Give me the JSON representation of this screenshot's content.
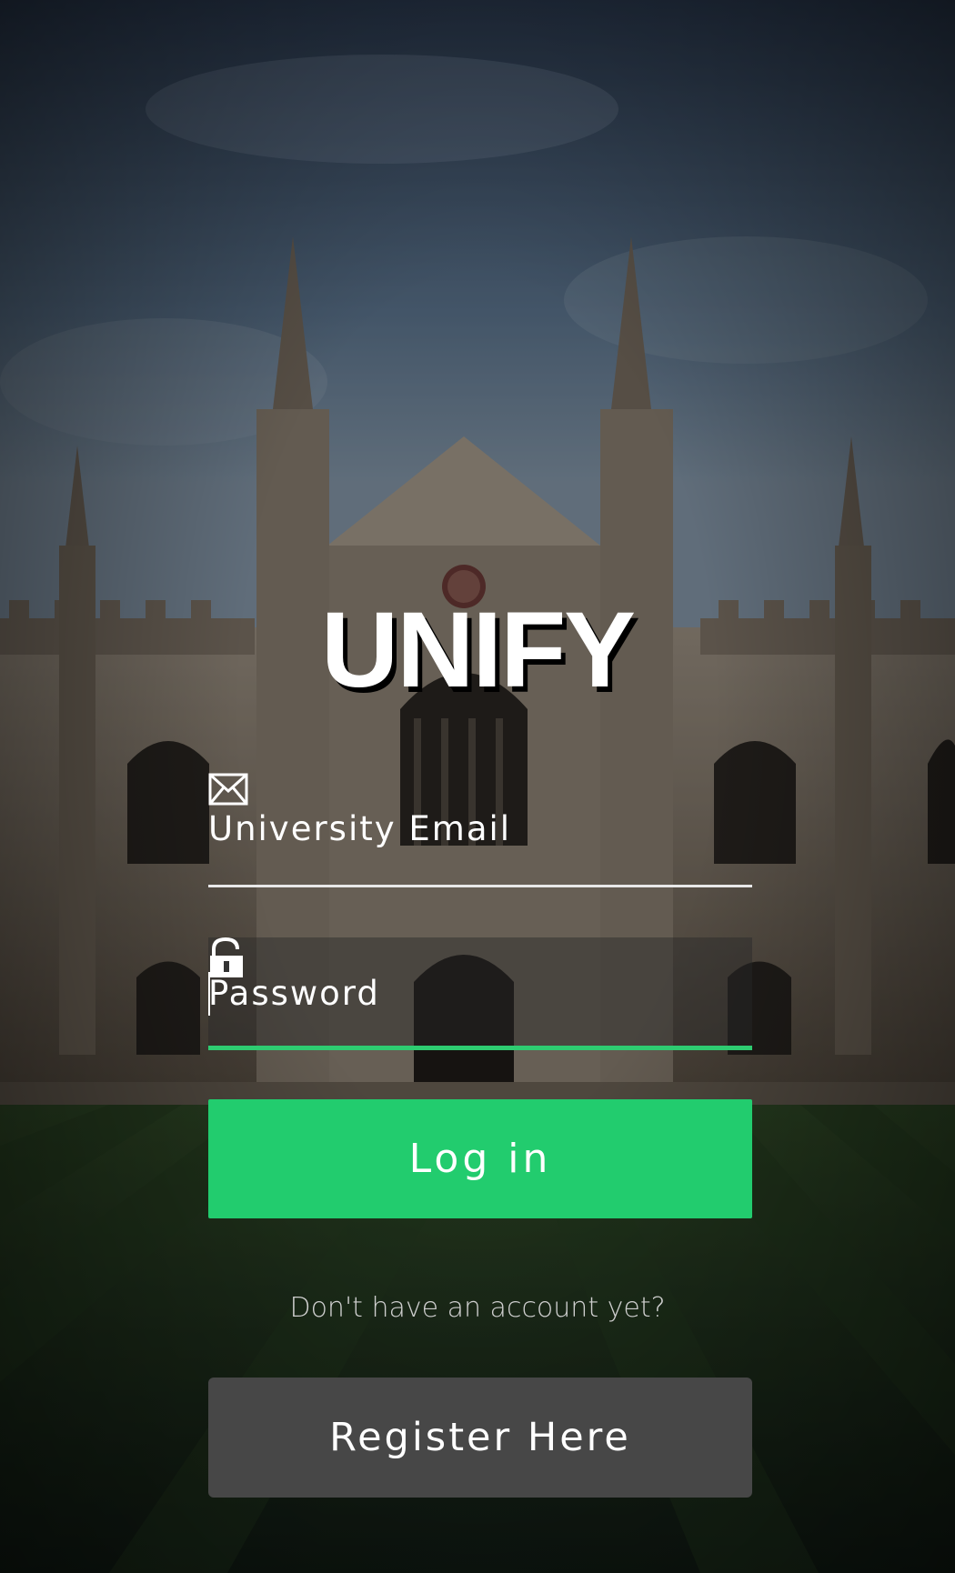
{
  "app": {
    "title": "UNIFY"
  },
  "login_form": {
    "email": {
      "label": "University Email",
      "icon": "envelope-icon",
      "value": ""
    },
    "password": {
      "label": "Password",
      "icon": "lock-icon",
      "value": "",
      "focused": true
    },
    "login_label": "Log in"
  },
  "register": {
    "prompt": "Don't have an account yet?",
    "button_label": "Register Here"
  },
  "colors": {
    "accent": "#22cc6e",
    "register_button": "#474747",
    "text": "#ffffff",
    "muted_text": "#cfcfcf"
  }
}
